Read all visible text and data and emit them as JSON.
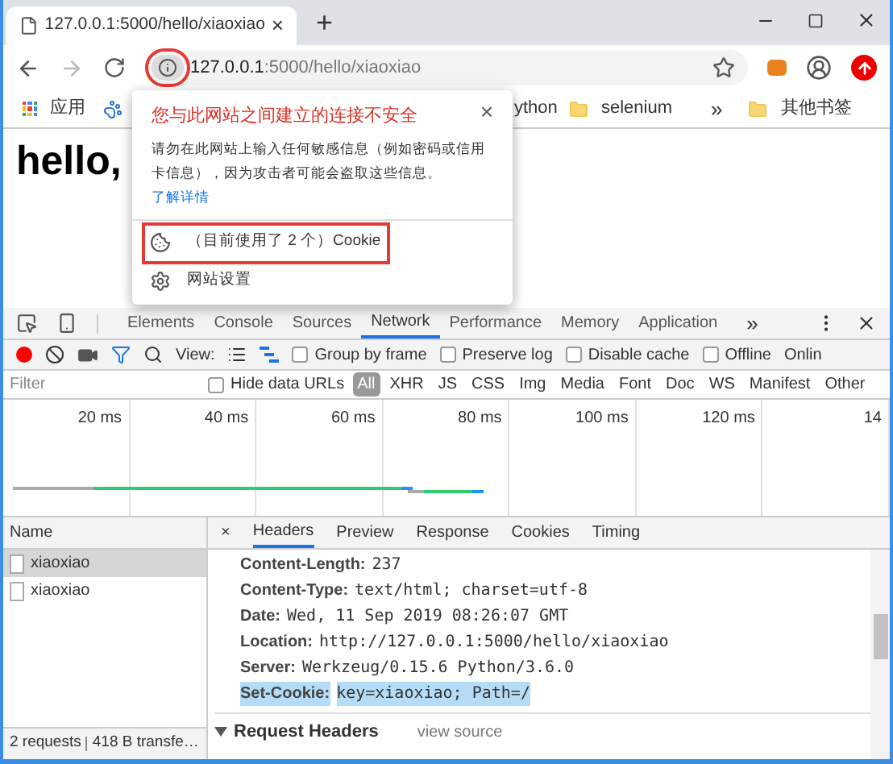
{
  "browser_tab": {
    "title": "127.0.0.1:5000/hello/xiaoxiao",
    "close": "×"
  },
  "new_tab": "+",
  "address_bar": {
    "host": "127.0.0.1",
    "path": ":5000/hello/xiaoxiao",
    "annotated": true
  },
  "bookmarks": [
    {
      "kind": "apps",
      "label": "应用"
    },
    {
      "kind": "paw"
    },
    {
      "kind": "text",
      "label": "ython"
    },
    {
      "kind": "folder",
      "label": "selenium"
    },
    {
      "kind": "more",
      "label": "»"
    },
    {
      "kind": "folder",
      "label": "其他书签"
    }
  ],
  "page": {
    "heading": "hello,"
  },
  "site_info_popup": {
    "title": "您与此网站之间建立的连接不安全",
    "close": "×",
    "message": "请勿在此网站上输入任何敏感信息（例如密码或信用卡信息），因为攻击者可能会盗取这些信息。",
    "link": "了解详情",
    "items": [
      {
        "kind": "cookie",
        "label": "（目前使用了 2 个）Cookie",
        "annotated": true
      },
      {
        "kind": "settings",
        "label": "网站设置",
        "annotated": false
      }
    ]
  },
  "devtools_tabs": [
    {
      "label": "Elements",
      "selected": false
    },
    {
      "label": "Console",
      "selected": false
    },
    {
      "label": "Sources",
      "selected": false
    },
    {
      "label": "Network",
      "selected": true
    },
    {
      "label": "Performance",
      "selected": false
    },
    {
      "label": "Memory",
      "selected": false
    },
    {
      "label": "Application",
      "selected": false
    }
  ],
  "devtools_more": "»",
  "network_toolbar": {
    "view_label": "View:",
    "options": [
      {
        "label": "Group by frame",
        "checked": false
      },
      {
        "label": "Preserve log",
        "checked": false
      },
      {
        "label": "Disable cache",
        "checked": false
      },
      {
        "label": "Offline",
        "checked": false
      }
    ],
    "throttle": "Onlin"
  },
  "filter_bar": {
    "placeholder": "Filter",
    "hide_data_urls": {
      "label": "Hide data URLs",
      "checked": false
    },
    "types": [
      {
        "label": "All",
        "selected": true
      },
      {
        "label": "XHR",
        "selected": false
      },
      {
        "label": "JS",
        "selected": false
      },
      {
        "label": "CSS",
        "selected": false
      },
      {
        "label": "Img",
        "selected": false
      },
      {
        "label": "Media",
        "selected": false
      },
      {
        "label": "Font",
        "selected": false
      },
      {
        "label": "Doc",
        "selected": false
      },
      {
        "label": "WS",
        "selected": false
      },
      {
        "label": "Manifest",
        "selected": false
      },
      {
        "label": "Other",
        "selected": false
      }
    ]
  },
  "timeline_ticks": [
    "20 ms",
    "40 ms",
    "60 ms",
    "80 ms",
    "100 ms",
    "120 ms",
    "14"
  ],
  "requests": {
    "column": "Name",
    "rows": [
      {
        "name": "xiaoxiao",
        "selected": true
      },
      {
        "name": "xiaoxiao",
        "selected": false
      }
    ],
    "status": [
      "2 requests",
      "418 B transfe…"
    ]
  },
  "detail_tabs": {
    "close": "×",
    "tabs": [
      {
        "label": "Headers",
        "selected": true
      },
      {
        "label": "Preview",
        "selected": false
      },
      {
        "label": "Response",
        "selected": false
      },
      {
        "label": "Cookies",
        "selected": false
      },
      {
        "label": "Timing",
        "selected": false
      }
    ]
  },
  "response_headers": [
    {
      "name": "Content-Length:",
      "value": "237",
      "highlighted": false
    },
    {
      "name": "Content-Type:",
      "value": "text/html; charset=utf-8",
      "highlighted": false
    },
    {
      "name": "Date:",
      "value": "Wed, 11 Sep 2019 08:26:07 GMT",
      "highlighted": false
    },
    {
      "name": "Location:",
      "value": "http://127.0.0.1:5000/hello/xiaoxiao",
      "highlighted": false
    },
    {
      "name": "Server:",
      "value": "Werkzeug/0.15.6 Python/3.6.0",
      "highlighted": false
    },
    {
      "name": "Set-Cookie:",
      "value": "key=xiaoxiao; Path=/",
      "highlighted": true
    }
  ],
  "request_headers": {
    "title": "Request Headers",
    "expanded": true,
    "view_source": "view source"
  }
}
